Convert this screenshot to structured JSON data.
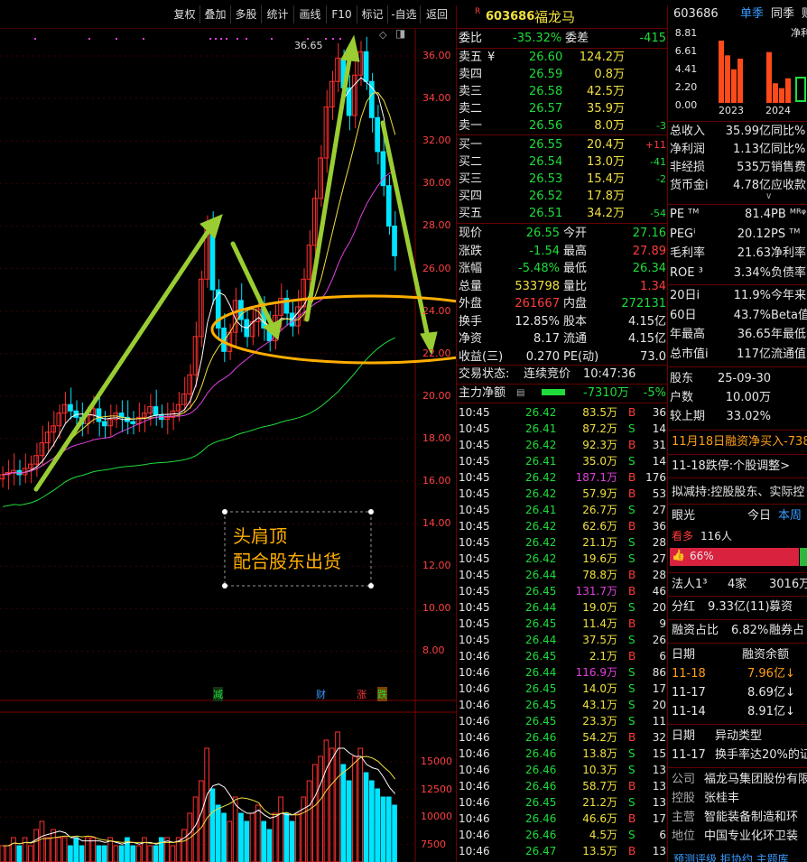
{
  "toolbar": {
    "buttons": [
      "复权",
      "叠加",
      "多股",
      "统计",
      "画线",
      "F10",
      "标记",
      "-自选",
      "返回"
    ]
  },
  "chart": {
    "price_axis": [
      "36.00",
      "34.00",
      "32.00",
      "30.00",
      "28.00",
      "26.00",
      "24.00",
      "22.00",
      "20.00",
      "18.00",
      "16.00",
      "14.00",
      "12.00",
      "10.00",
      "8.00"
    ],
    "high_marker": "36.65",
    "volume_axis": [
      "15000",
      "12500",
      "10000",
      "7500"
    ],
    "event_marks": {
      "reduce": "减",
      "finance": "财",
      "rise": "涨",
      "fall": "跌"
    },
    "annotation": {
      "line1": "头肩顶",
      "line2": "配合股东出货"
    },
    "colors": {
      "up": "#ff3030",
      "down": "#00e5ff",
      "ma1": "#ffffff",
      "ma2": "#f0e040",
      "ma3": "#e040e0",
      "ma4": "#1fdc3a",
      "arrow_green": "#9acd32",
      "ellipse": "#ffae00"
    }
  },
  "quote": {
    "r_badge": "R",
    "code": "603686",
    "name": "福龙马",
    "weibi_label": "委比",
    "weibi_value": "-35.32%",
    "weicha_label": "委差",
    "weicha_value": "-415",
    "asks": [
      {
        "label": "卖五",
        "price": "26.60",
        "vol": "124.2万",
        "chg": ""
      },
      {
        "label": "卖四",
        "price": "26.59",
        "vol": "0.8万",
        "chg": ""
      },
      {
        "label": "卖三",
        "price": "26.58",
        "vol": "42.5万",
        "chg": ""
      },
      {
        "label": "卖二",
        "price": "26.57",
        "vol": "35.9万",
        "chg": ""
      },
      {
        "label": "卖一",
        "price": "26.56",
        "vol": "8.0万",
        "chg": "-3"
      }
    ],
    "yuan_mark": "¥",
    "bids": [
      {
        "label": "买一",
        "price": "26.55",
        "vol": "20.4万",
        "chg": "+11"
      },
      {
        "label": "买二",
        "price": "26.54",
        "vol": "13.0万",
        "chg": "-41"
      },
      {
        "label": "买三",
        "price": "26.53",
        "vol": "15.4万",
        "chg": "-2"
      },
      {
        "label": "买四",
        "price": "26.52",
        "vol": "17.8万",
        "chg": ""
      },
      {
        "label": "买五",
        "price": "26.51",
        "vol": "34.2万",
        "chg": "-54"
      }
    ],
    "stats": [
      {
        "l1": "现价",
        "v1": "26.55",
        "l2": "今开",
        "v2": "27.16"
      },
      {
        "l1": "涨跌",
        "v1": "-1.54",
        "l2": "最高",
        "v2": "27.89"
      },
      {
        "l1": "涨幅",
        "v1": "-5.48%",
        "l2": "最低",
        "v2": "26.34"
      },
      {
        "l1": "总量",
        "v1": "533798",
        "l2": "量比",
        "v2": "1.34"
      },
      {
        "l1": "外盘",
        "v1": "261667",
        "l2": "内盘",
        "v2": "272131"
      },
      {
        "l1": "换手",
        "v1": "12.85%",
        "l2": "股本",
        "v2": "4.15亿"
      },
      {
        "l1": "净资",
        "v1": "8.17",
        "l2": "流通",
        "v2": "4.15亿"
      },
      {
        "l1": "收益(三)",
        "v1": "0.270",
        "l2": "PE(动)",
        "v2": "73.0"
      }
    ],
    "trade_status_label": "交易状态:",
    "trade_status": "连续竞价",
    "trade_time": "10:47:36",
    "main_flow_label": "主力净额",
    "main_flow_value": "-7310万",
    "main_flow_pct": "-5%",
    "ticks": [
      {
        "t": "10:45",
        "p": "26.42",
        "v": "83.5万",
        "d": "B",
        "n": "36"
      },
      {
        "t": "10:45",
        "p": "26.41",
        "v": "87.2万",
        "d": "S",
        "n": "14"
      },
      {
        "t": "10:45",
        "p": "26.42",
        "v": "92.3万",
        "d": "B",
        "n": "31"
      },
      {
        "t": "10:45",
        "p": "26.41",
        "v": "35.0万",
        "d": "S",
        "n": "14"
      },
      {
        "t": "10:45",
        "p": "26.42",
        "v": "187.1万",
        "d": "B",
        "n": "176"
      },
      {
        "t": "10:45",
        "p": "26.42",
        "v": "57.9万",
        "d": "B",
        "n": "53"
      },
      {
        "t": "10:45",
        "p": "26.41",
        "v": "26.7万",
        "d": "S",
        "n": "27"
      },
      {
        "t": "10:45",
        "p": "26.42",
        "v": "62.6万",
        "d": "B",
        "n": "36"
      },
      {
        "t": "10:45",
        "p": "26.42",
        "v": "21.1万",
        "d": "S",
        "n": "28"
      },
      {
        "t": "10:45",
        "p": "26.42",
        "v": "19.6万",
        "d": "S",
        "n": "27"
      },
      {
        "t": "10:45",
        "p": "26.44",
        "v": "78.8万",
        "d": "B",
        "n": "28"
      },
      {
        "t": "10:45",
        "p": "26.45",
        "v": "131.7万",
        "d": "B",
        "n": "46"
      },
      {
        "t": "10:45",
        "p": "26.44",
        "v": "19.0万",
        "d": "S",
        "n": "20"
      },
      {
        "t": "10:45",
        "p": "26.45",
        "v": "11.4万",
        "d": "B",
        "n": "9"
      },
      {
        "t": "10:45",
        "p": "26.44",
        "v": "37.5万",
        "d": "S",
        "n": "26"
      },
      {
        "t": "10:46",
        "p": "26.45",
        "v": "2.1万",
        "d": "B",
        "n": "6"
      },
      {
        "t": "10:46",
        "p": "26.44",
        "v": "116.9万",
        "d": "S",
        "n": "86"
      },
      {
        "t": "10:46",
        "p": "26.45",
        "v": "14.0万",
        "d": "S",
        "n": "17"
      },
      {
        "t": "10:46",
        "p": "26.45",
        "v": "43.1万",
        "d": "S",
        "n": "20"
      },
      {
        "t": "10:46",
        "p": "26.45",
        "v": "23.3万",
        "d": "S",
        "n": "11"
      },
      {
        "t": "10:46",
        "p": "26.46",
        "v": "54.2万",
        "d": "B",
        "n": "32"
      },
      {
        "t": "10:46",
        "p": "26.46",
        "v": "13.8万",
        "d": "S",
        "n": "15"
      },
      {
        "t": "10:46",
        "p": "26.46",
        "v": "10.3万",
        "d": "S",
        "n": "13"
      },
      {
        "t": "10:46",
        "p": "26.46",
        "v": "58.7万",
        "d": "B",
        "n": "13"
      },
      {
        "t": "10:46",
        "p": "26.45",
        "v": "21.2万",
        "d": "S",
        "n": "13"
      },
      {
        "t": "10:46",
        "p": "26.46",
        "v": "46.6万",
        "d": "B",
        "n": "17"
      },
      {
        "t": "10:46",
        "p": "26.46",
        "v": "4.5万",
        "d": "S",
        "n": "6"
      },
      {
        "t": "10:46",
        "p": "26.47",
        "v": "13.5万",
        "d": "B",
        "n": "13"
      }
    ]
  },
  "info": {
    "code": "603686",
    "tab1": "单季",
    "tab2": "同季",
    "tab3": "财",
    "mini_chart": {
      "y_labels": [
        "8.81",
        "6.61",
        "4.41",
        "2.20",
        "0.00"
      ],
      "x_labels": [
        "2023",
        "2024"
      ],
      "extra": "净利"
    },
    "rows1": [
      {
        "l": "总收入",
        "v": "35.99亿",
        "l2": "同比%"
      },
      {
        "l": "净利润",
        "v": "1.13亿",
        "l2": "同比%"
      },
      {
        "l": "非经损",
        "v": "535万",
        "l2": "销售费"
      },
      {
        "l": "货币金i",
        "v": "4.78亿",
        "l2": "应收款"
      }
    ],
    "rows2": [
      {
        "l": "PE ᵀᴹ",
        "v": "81.4",
        "l2": "PB ᴹᴿᵠ"
      },
      {
        "l": "PEGⁱ",
        "v": "20.12",
        "l2": "PS ᵀᴹ"
      },
      {
        "l": "毛利率",
        "v": "21.63",
        "l2": "净利率"
      },
      {
        "l": "ROE ³",
        "v": "3.34%",
        "l2": "负债率"
      }
    ],
    "rows3": [
      {
        "l": "20日i",
        "v": "11.9%",
        "l2": "今年来"
      },
      {
        "l": "60日",
        "v": "43.7%",
        "l2": "Beta值"
      },
      {
        "l": "年最高",
        "v": "36.65",
        "l2": "年最低"
      },
      {
        "l": "总市值i",
        "v": "117亿",
        "l2": "流通值"
      }
    ],
    "holders": [
      {
        "l": "股东",
        "v": "25-09-30"
      },
      {
        "l": "户数",
        "v": "10.00万"
      },
      {
        "l": "较上期",
        "v": "33.02%"
      }
    ],
    "margin_news": "11月18日融资净买入-738",
    "news1": "11-18跌停:个股调整>",
    "news2": "拟减持:控股股东、实际控",
    "eye_label": "眼光",
    "eye_today": "今日",
    "eye_week": "本周",
    "bull_label": "看多",
    "bull_count": "116人",
    "bull_pct": "66%",
    "legal": {
      "l": "法人1³",
      "v1": "4家",
      "v2": "3016万"
    },
    "dividend": {
      "l": "分红",
      "v": "9.33亿(11)",
      "l2": "募资"
    },
    "margin_ratio": {
      "l": "融资占比",
      "v": "6.82%",
      "l2": "融券占"
    },
    "margin_header": {
      "l": "日期",
      "v": "融资余额"
    },
    "margin_rows": [
      {
        "d": "11-18",
        "v": "7.96亿↓"
      },
      {
        "d": "11-17",
        "v": "8.69亿↓"
      },
      {
        "d": "11-14",
        "v": "8.91亿↓"
      }
    ],
    "abnormal_header": {
      "l": "日期",
      "v": "异动类型"
    },
    "abnormal_row": {
      "d": "11-17",
      "v": "换手率达20%的证"
    },
    "company": [
      {
        "l": "公司",
        "v": "福龙马集团股份有限"
      },
      {
        "l": "控股",
        "v": "张桂丰"
      },
      {
        "l": "主营",
        "v": "智能装备制造和环"
      },
      {
        "l": "地位",
        "v": "中国专业化环卫装"
      }
    ],
    "bottom_hint": "预测评级 拒协约 主题库"
  }
}
